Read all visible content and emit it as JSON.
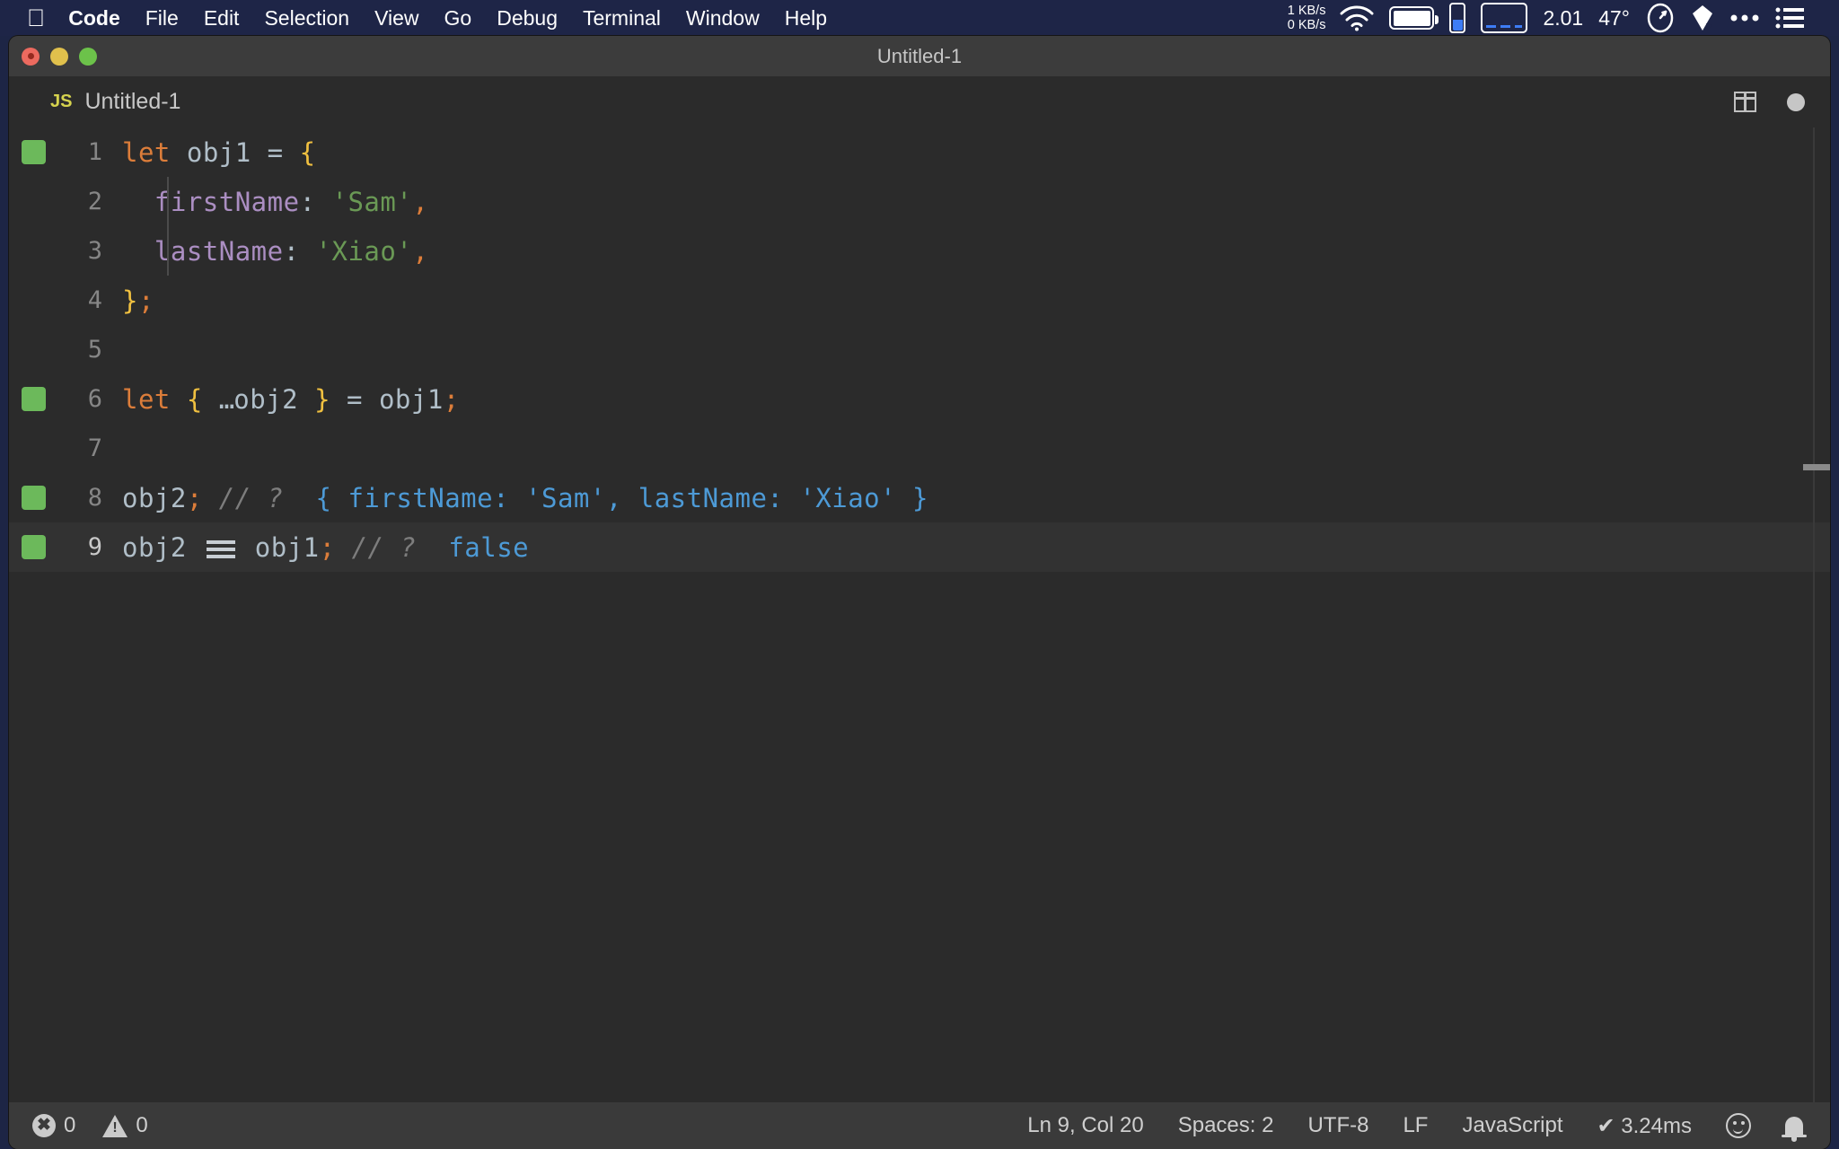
{
  "menubar": {
    "apple_icon": "apple-logo-icon",
    "items": [
      {
        "label": "Code",
        "bold": true
      },
      {
        "label": "File",
        "bold": false
      },
      {
        "label": "Edit",
        "bold": false
      },
      {
        "label": "Selection",
        "bold": false
      },
      {
        "label": "View",
        "bold": false
      },
      {
        "label": "Go",
        "bold": false
      },
      {
        "label": "Debug",
        "bold": false
      },
      {
        "label": "Terminal",
        "bold": false
      },
      {
        "label": "Window",
        "bold": false
      },
      {
        "label": "Help",
        "bold": false
      }
    ],
    "status": {
      "net_up": "1 KB/s",
      "net_down": "0 KB/s",
      "wifi_icon": "wifi-icon",
      "battery_icon": "battery-icon",
      "minibar_icon": "battery-gauge-icon",
      "dashbox_icon": "memory-gauge-icon",
      "cpu_value": "2.01",
      "temperature": "47°",
      "speedometer_icon": "speedometer-icon",
      "dropbox_icon": "dropbox-icon",
      "overflow_icon": "ellipsis-icon",
      "list_icon": "list-menu-icon"
    },
    "bg_color": "#1e2547"
  },
  "window": {
    "title": "Untitled-1",
    "traffic_lights": [
      "close-button",
      "minimize-button",
      "zoom-button"
    ]
  },
  "tabbar": {
    "tab": {
      "file_type_badge": "JS",
      "label": "Untitled-1"
    },
    "actions": [
      {
        "name": "split-editor-icon"
      },
      {
        "name": "unsaved-dot-icon"
      }
    ]
  },
  "editor": {
    "language": "JavaScript",
    "current_line": 9,
    "lines": [
      {
        "num": "1",
        "marker": true,
        "active": false,
        "indent_guide": false,
        "text": "let obj1 = {"
      },
      {
        "num": "2",
        "marker": false,
        "active": false,
        "indent_guide": true,
        "text": "  firstName: 'Sam',"
      },
      {
        "num": "3",
        "marker": false,
        "active": false,
        "indent_guide": true,
        "text": "  lastName: 'Xiao',"
      },
      {
        "num": "4",
        "marker": false,
        "active": false,
        "indent_guide": false,
        "text": "};"
      },
      {
        "num": "5",
        "marker": false,
        "active": false,
        "indent_guide": false,
        "text": ""
      },
      {
        "num": "6",
        "marker": true,
        "active": false,
        "indent_guide": false,
        "text": "let { ...obj2 } = obj1;"
      },
      {
        "num": "7",
        "marker": false,
        "active": false,
        "indent_guide": false,
        "text": ""
      },
      {
        "num": "8",
        "marker": true,
        "active": false,
        "indent_guide": false,
        "text": "obj2; // ?  { firstName: 'Sam', lastName: 'Xiao' }"
      },
      {
        "num": "9",
        "marker": true,
        "active": true,
        "indent_guide": false,
        "text": "obj2 === obj1; // ?  false"
      }
    ],
    "tokens": {
      "line1": {
        "kw": "let",
        "var": "obj1",
        "op": "=",
        "brace": "{"
      },
      "line2": {
        "prop": "firstName",
        "colon": ":",
        "str": "'Sam'",
        "punc": ","
      },
      "line3": {
        "prop": "lastName",
        "colon": ":",
        "str": "'Xiao'",
        "punc": ","
      },
      "line4": {
        "brace": "}",
        "punc": ";"
      },
      "line6": {
        "kw": "let",
        "brace_open": "{",
        "spread": "...",
        "var": "obj2",
        "brace_close": "}",
        "op": "=",
        "var2": "obj1",
        "punc": ";"
      },
      "line8": {
        "var": "obj2",
        "punc": ";",
        "comment": "// ?",
        "hint": "{ firstName: 'Sam', lastName: 'Xiao' }"
      },
      "line9": {
        "var": "obj2",
        "eq": "===",
        "var2": "obj1",
        "punc": ";",
        "comment": "// ?",
        "hint": "false"
      }
    },
    "colors": {
      "background": "#2b2b2b",
      "current_line": "#323232",
      "keyword": "#dc7d3a",
      "identifier": "#b0bec8",
      "brace": "#f0c040",
      "property": "#ab8ec2",
      "string": "#6a9955",
      "comment": "#7d7d7d",
      "inline_hint": "#4d9ad6",
      "marker_green": "#6cb95b"
    }
  },
  "statusbar": {
    "errors_icon": "error-circle-icon",
    "errors": "0",
    "warnings_icon": "warning-triangle-icon",
    "warnings": "0",
    "cursor_position": "Ln 9, Col 20",
    "indentation": "Spaces: 2",
    "encoding": "UTF-8",
    "eol": "LF",
    "language": "JavaScript",
    "run_time": "✔ 3.24ms",
    "feedback_icon": "smiley-icon",
    "notification_icon": "bell-icon"
  }
}
